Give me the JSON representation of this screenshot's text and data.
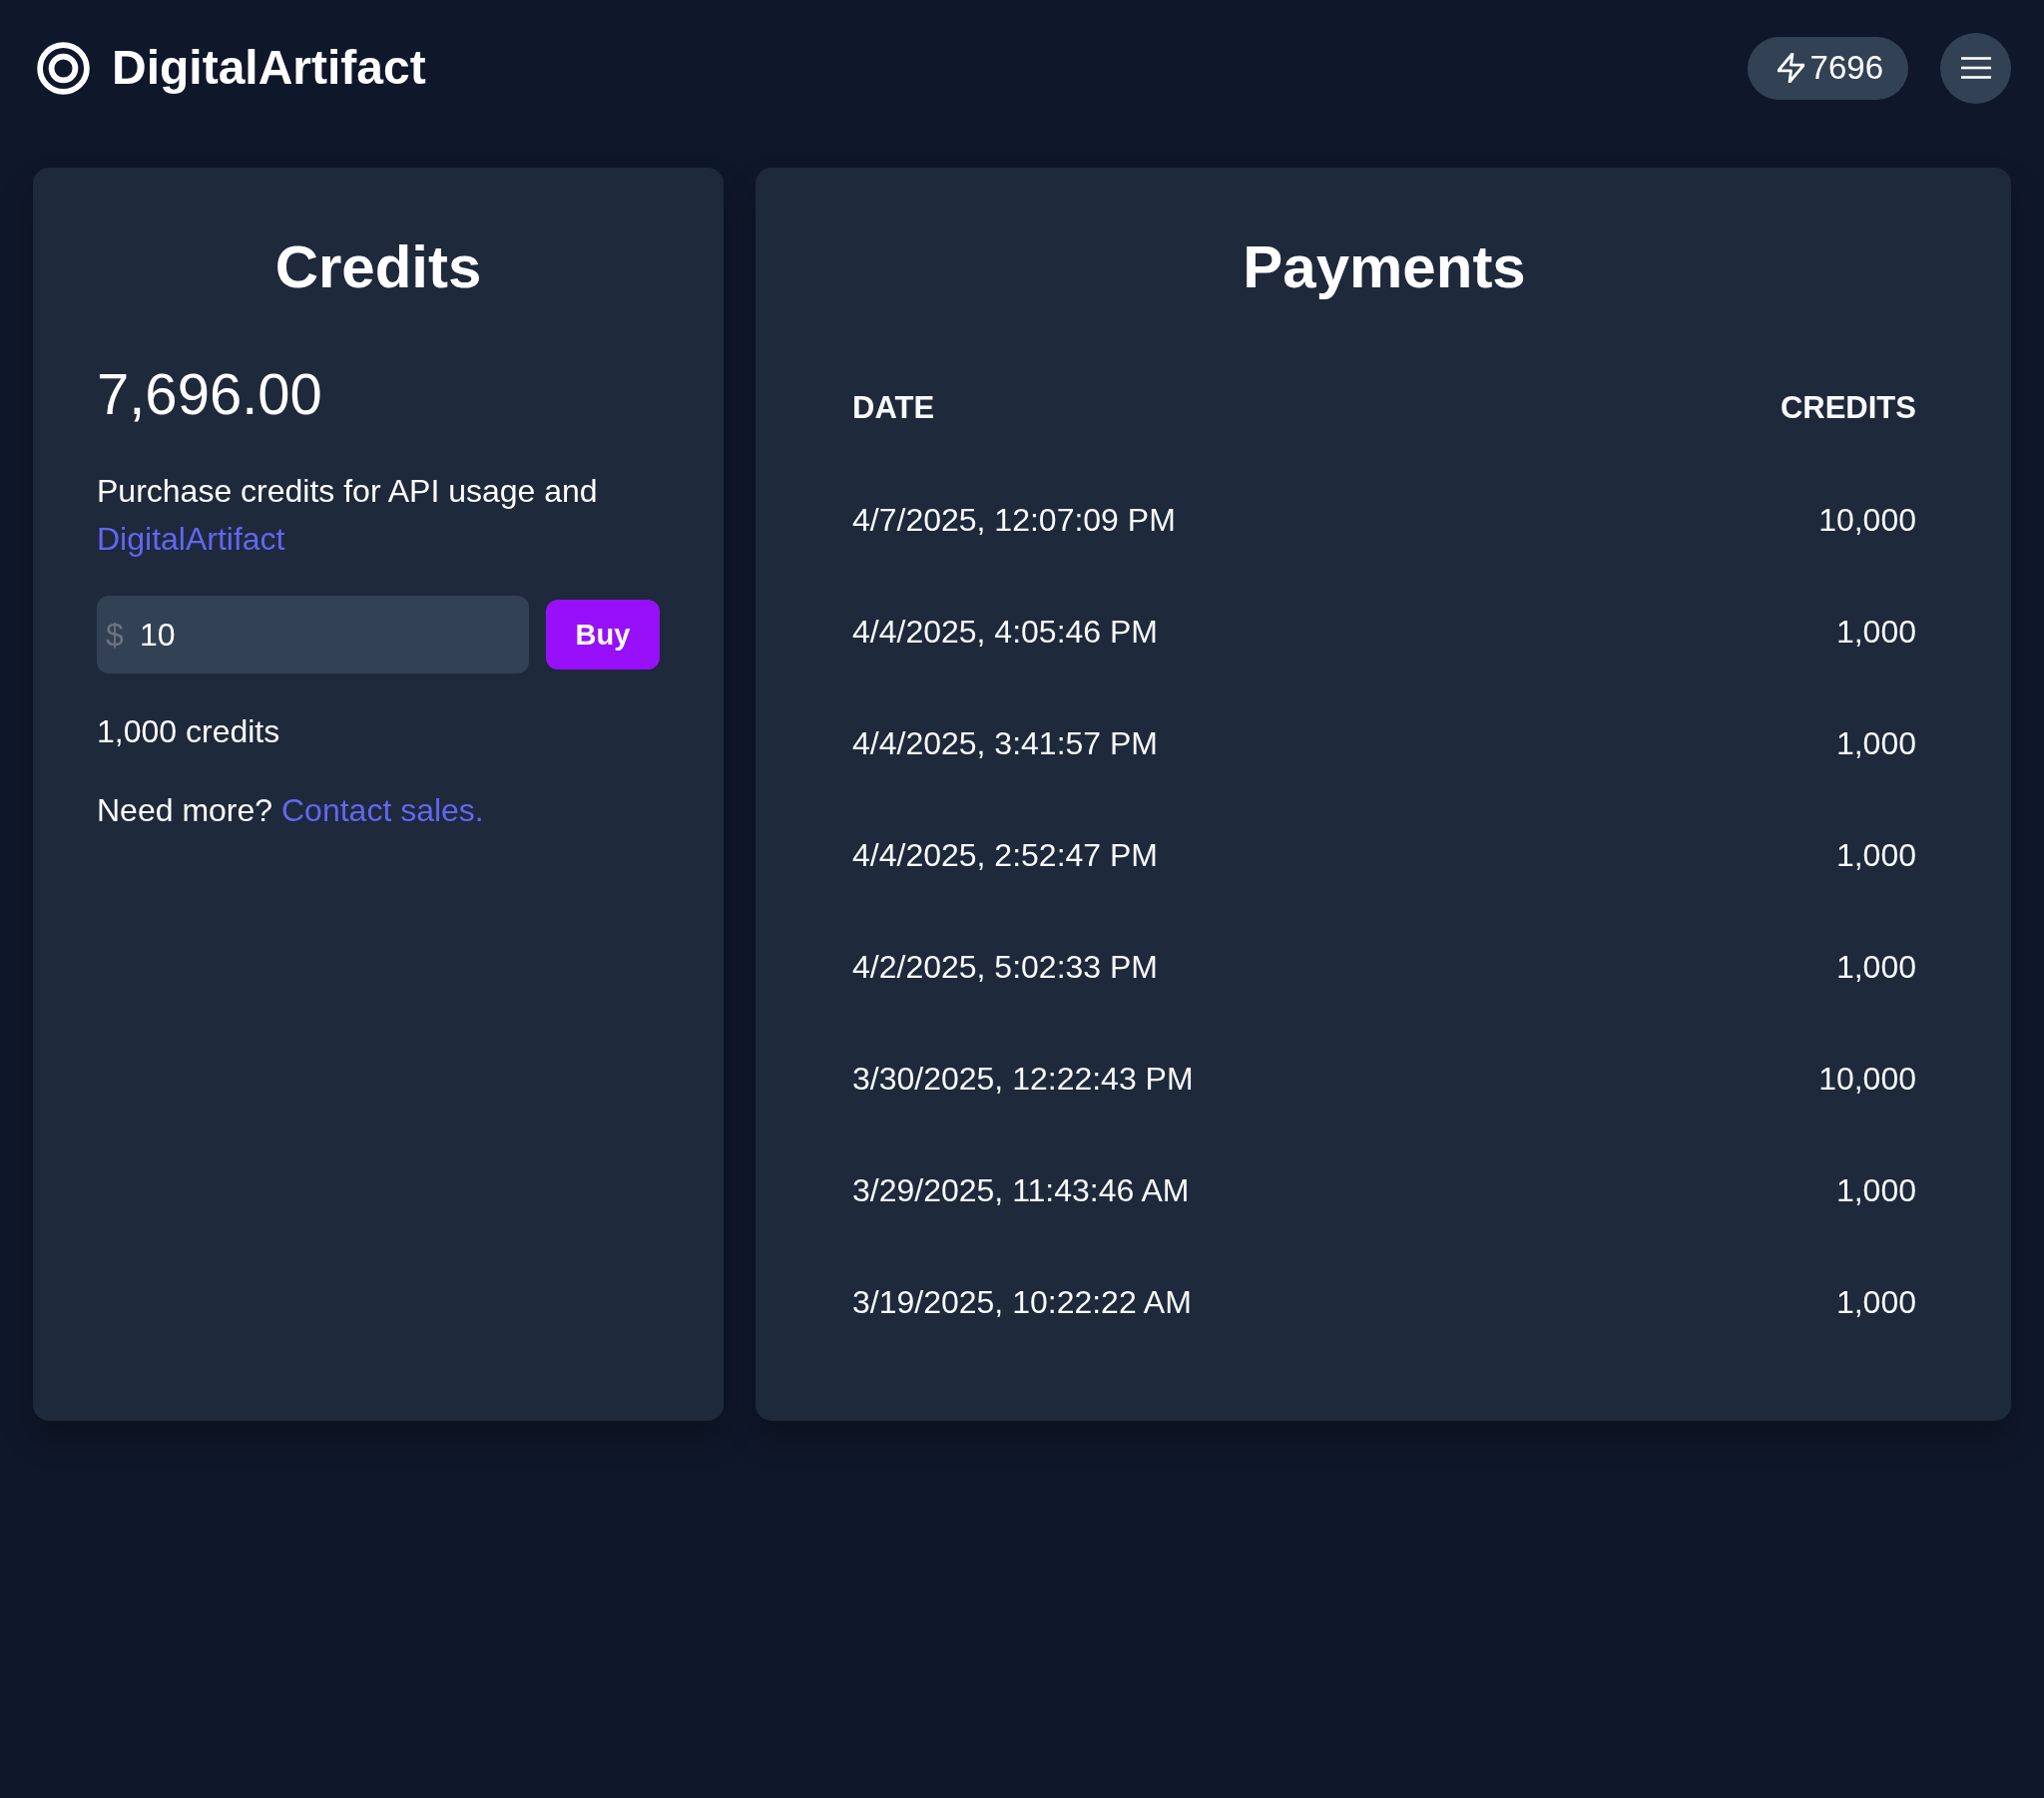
{
  "header": {
    "brand": "DigitalArtifact",
    "credit_badge": "7696"
  },
  "credits_card": {
    "title": "Credits",
    "balance": "7,696.00",
    "description": "Purchase credits for API usage and",
    "description_link": "DigitalArtifact",
    "amount_field": {
      "prefix": "$",
      "value": "10"
    },
    "buy_button": "Buy",
    "credit_estimate": "1,000 credits",
    "contact_text": "Need more?",
    "contact_link": "Contact sales."
  },
  "payments_card": {
    "title": "Payments",
    "table": {
      "columns": [
        "DATE",
        "CREDITS"
      ],
      "rows": [
        [
          "4/7/2025, 12:07:09 PM",
          "10,000"
        ],
        [
          "4/4/2025, 4:05:46 PM",
          "1,000"
        ],
        [
          "4/4/2025, 3:41:57 PM",
          "1,000"
        ],
        [
          "4/4/2025, 2:52:47 PM",
          "1,000"
        ],
        [
          "4/2/2025, 5:02:33 PM",
          "1,000"
        ],
        [
          "3/30/2025, 12:22:43 PM",
          "10,000"
        ],
        [
          "3/29/2025, 11:43:46 AM",
          "1,000"
        ],
        [
          "3/19/2025, 10:22:22 AM",
          "1,000"
        ]
      ]
    }
  }
}
